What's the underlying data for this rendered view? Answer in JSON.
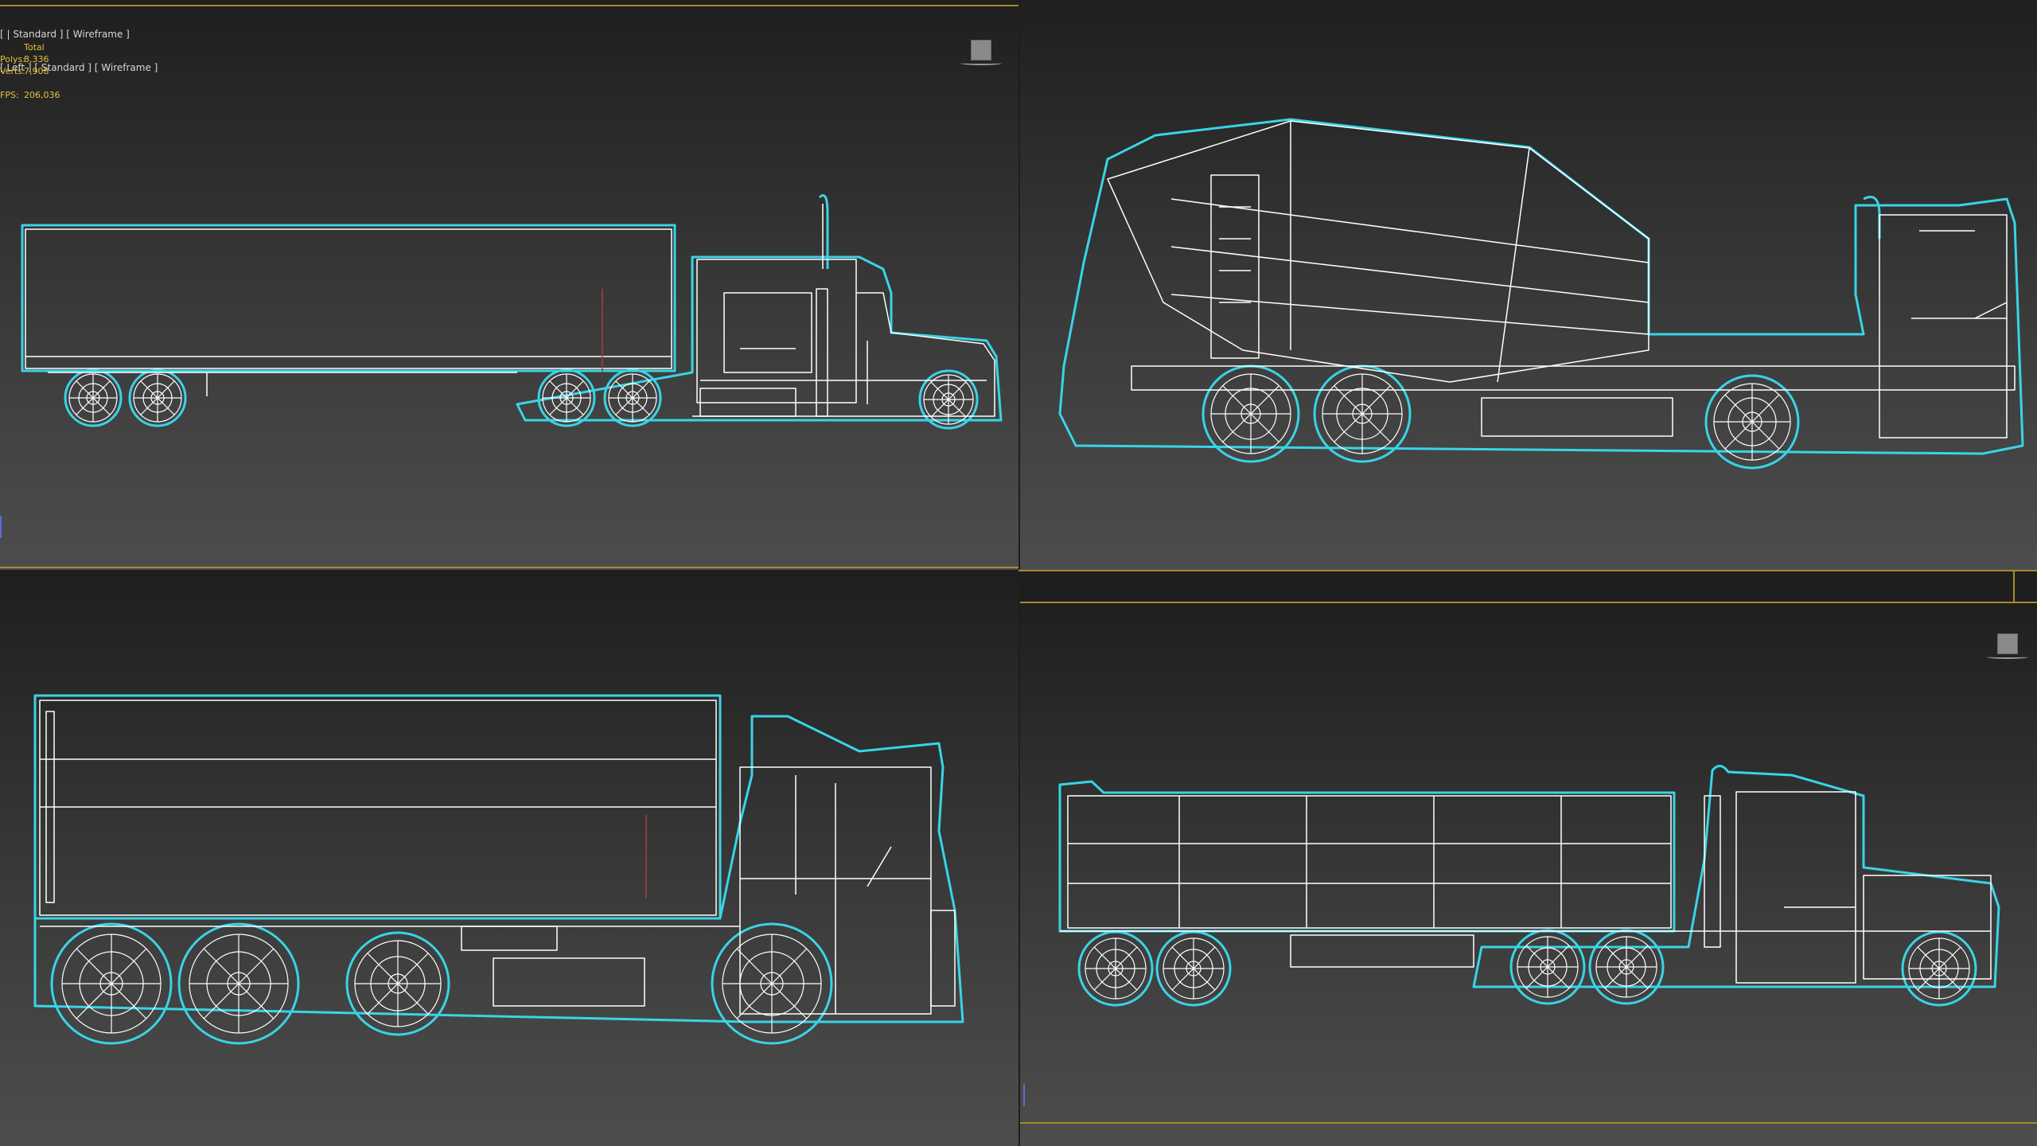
{
  "viewports": {
    "top_left": {
      "label": "[ | Standard ] [ Wireframe ]",
      "label2": "[ Left ] [ Standard ] [ Wireframe ]",
      "stats": {
        "header": "Total",
        "polys_key": "Polys:",
        "polys": "8,336",
        "verts_key": "Verts:",
        "verts": "7,908",
        "fps_key": "FPS:",
        "fps": "206,036"
      }
    },
    "top_right": {
      "subject": "concrete mixer truck wireframe"
    },
    "bottom_left": {
      "subject": "box truck with trailer wireframe"
    },
    "bottom_right": {
      "subject": "tanker semi truck wireframe"
    }
  },
  "colors": {
    "viewport_border": "#a88a2a",
    "selection_outline": "#39d4e6",
    "wire": "#ffffff",
    "stats_text": "#e6c23a"
  },
  "icons": [
    "viewcube-icon",
    "axis-gizmo-icon"
  ]
}
